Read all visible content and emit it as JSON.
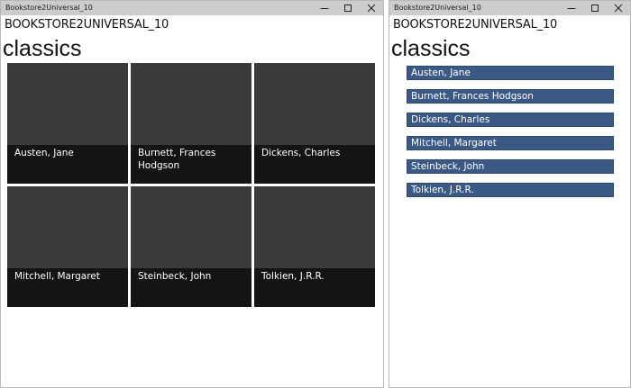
{
  "windows": [
    {
      "title": "Bookstore2Universal_10",
      "app_name": "BOOKSTORE2UNIVERSAL_10",
      "page_title": "classics",
      "authors": [
        "Austen, Jane",
        "Burnett, Frances Hodgson",
        "Dickens, Charles",
        "Mitchell, Margaret",
        "Steinbeck, John",
        "Tolkien, J.R.R."
      ]
    },
    {
      "title": "Bookstore2Universal_10",
      "app_name": "BOOKSTORE2UNIVERSAL_10",
      "page_title": "classics",
      "authors": [
        "Austen, Jane",
        "Burnett, Frances Hodgson",
        "Dickens, Charles",
        "Mitchell, Margaret",
        "Steinbeck, John",
        "Tolkien, J.R.R."
      ]
    }
  ],
  "colors": {
    "tile_image": "#3b3b3b",
    "tile_caption": "#141414",
    "list_item": "#3a5a85",
    "titlebar": "#cccccc"
  },
  "icons": {
    "minimize": "minimize-icon",
    "maximize": "maximize-icon",
    "close": "close-icon"
  }
}
